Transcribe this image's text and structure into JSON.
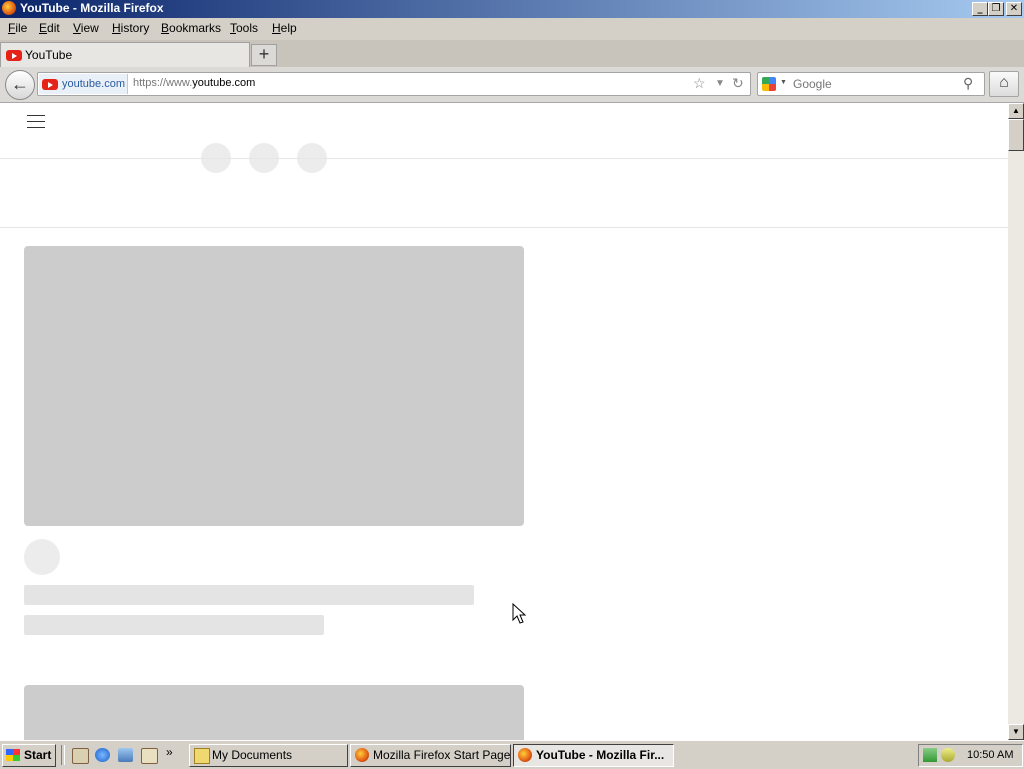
{
  "window": {
    "title": "YouTube - Mozilla Firefox"
  },
  "menu": [
    "File",
    "Edit",
    "View",
    "History",
    "Bookmarks",
    "Tools",
    "Help"
  ],
  "menu_accel": [
    "F",
    "E",
    "V",
    "H",
    "B",
    "T",
    "H"
  ],
  "tab": {
    "label": "YouTube",
    "new_tab": "+"
  },
  "nav": {
    "identity_domain": "youtube.com",
    "url_prefix": "https://www.",
    "url_host": "youtube.com",
    "search_placeholder": "Google"
  },
  "taskbar": {
    "start_label": "Start",
    "tasks": [
      "My Documents",
      "Mozilla Firefox Start Page -...",
      "YouTube - Mozilla Fir..."
    ],
    "clock": "10:50 AM"
  },
  "icons": {
    "back": "back-arrow-icon",
    "bookmark": "star-icon",
    "history_dropdown": "chevron-down-icon",
    "reload": "reload-icon",
    "search": "magnifier-icon",
    "home": "home-icon"
  },
  "colors": {
    "titlebar": "#0a246a",
    "youtube_red": "#e62117",
    "placeholder": "#cccccc"
  }
}
